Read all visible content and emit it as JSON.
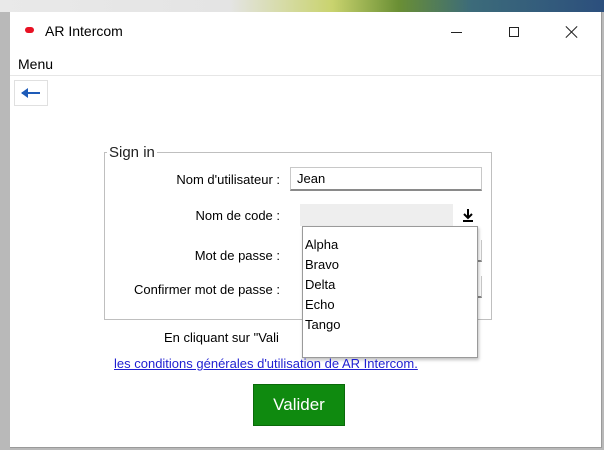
{
  "window": {
    "title": "AR Intercom",
    "minimize_icon": "minimize-icon",
    "maximize_icon": "maximize-icon",
    "close_icon": "close-icon"
  },
  "menu": {
    "label": "Menu"
  },
  "back_icon": "back-arrow-icon",
  "form": {
    "legend": "Sign in",
    "username_label": "Nom d'utilisateur :",
    "username_value": "Jean",
    "codename_label": "Nom de code :",
    "codename_value": "",
    "codename_options": [
      "Alpha",
      "Bravo",
      "Delta",
      "Echo",
      "Tango"
    ],
    "password_label": "Mot de passe :",
    "confirm_label": "Confirmer mot de passe :"
  },
  "notice_visible": "En cliquant sur \"Vali",
  "terms_link": "les conditions générales d'utilisation de AR Intercom.",
  "submit_label": "Valider",
  "colors": {
    "accent_green": "#0f8a0f",
    "link_blue": "#1f1fd1",
    "back_arrow": "#1e5bb8",
    "app_icon_red": "#e81123"
  }
}
